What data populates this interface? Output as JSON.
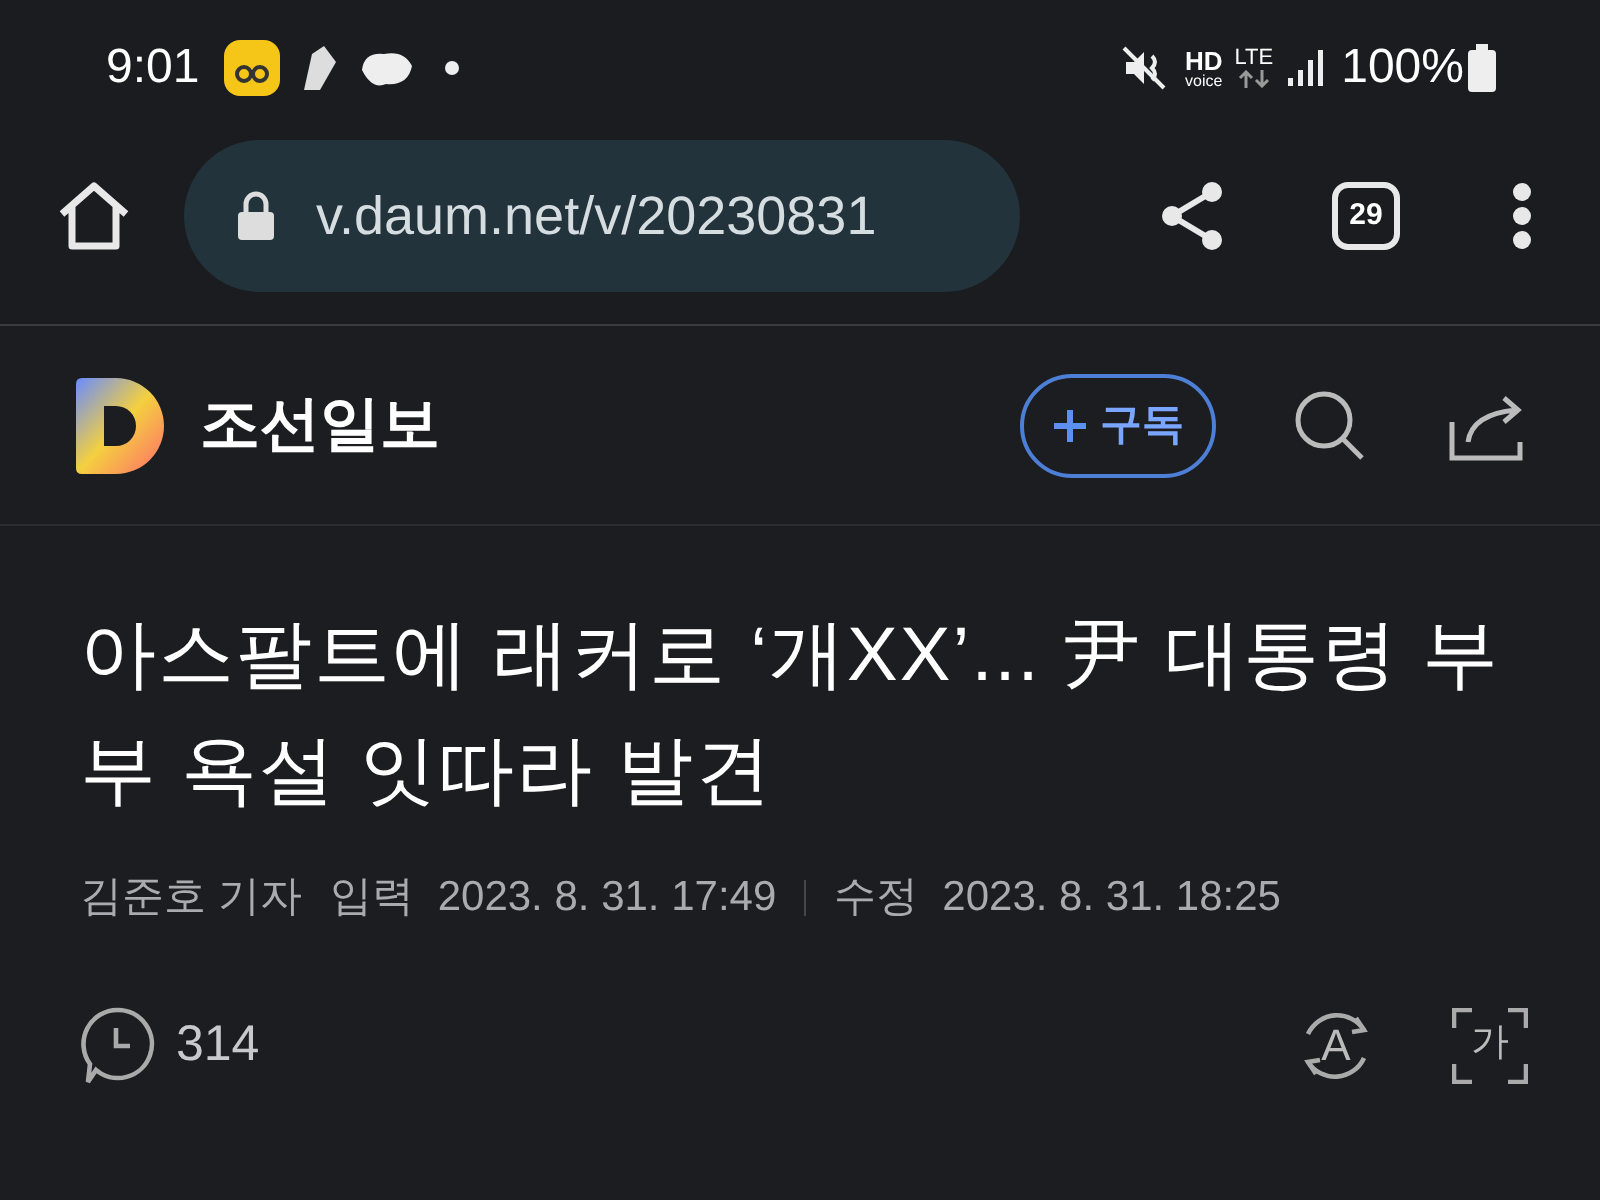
{
  "status_bar": {
    "time": "9:01",
    "hd": "HD",
    "voice": "voice",
    "network": "LTE",
    "battery": "100%"
  },
  "browser": {
    "url": "v.daum.net/v/20230831",
    "tab_count": "29"
  },
  "header": {
    "publisher": "조선일보",
    "subscribe": "구독"
  },
  "article": {
    "headline": "아스팔트에 래커로 ‘개XX’... 尹 대통령 부부 욕설 잇따라 발견",
    "reporter": "김준호 기자",
    "input_label": "입력",
    "input_time": "2023. 8. 31. 17:49",
    "edit_label": "수정",
    "edit_time": "2023. 8. 31. 18:25",
    "comment_count": "314",
    "translate_glyph": "A",
    "font_glyph": "가"
  }
}
